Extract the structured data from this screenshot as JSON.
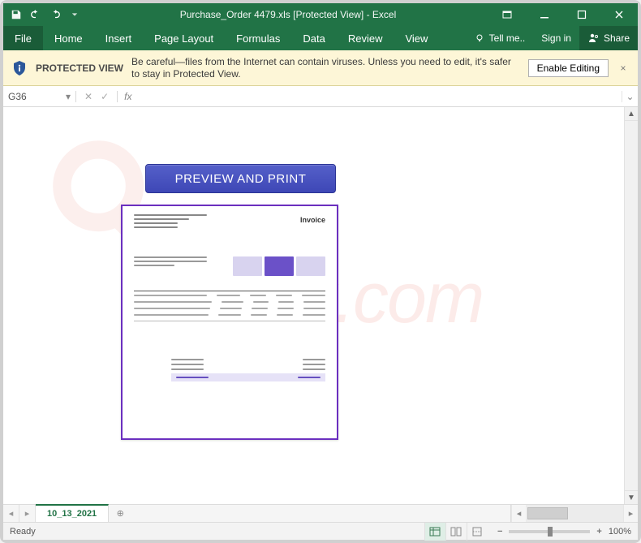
{
  "titlebar": {
    "title": "Purchase_Order 4479.xls  [Protected View] - Excel"
  },
  "ribbon": {
    "tabs": [
      "File",
      "Home",
      "Insert",
      "Page Layout",
      "Formulas",
      "Data",
      "Review",
      "View"
    ],
    "tell_me": "Tell me..",
    "sign_in": "Sign in",
    "share": "Share"
  },
  "messagebar": {
    "title": "PROTECTED VIEW",
    "text": "Be careful—files from the Internet can contain viruses. Unless you need to edit, it's safer to stay in Protected View.",
    "button": "Enable Editing"
  },
  "formula": {
    "namebox": "G36",
    "fx_label": "fx",
    "value": ""
  },
  "content": {
    "preview_button": "PREVIEW AND PRINT",
    "doc_title": "Invoice"
  },
  "tabs": {
    "sheet": "10_13_2021"
  },
  "status": {
    "ready": "Ready",
    "zoom": "100%"
  },
  "icons": {
    "save": "save",
    "undo": "undo",
    "redo": "redo",
    "restore": "restore",
    "minimize": "minimize",
    "maximize": "maximize",
    "close": "close",
    "bulb": "lightbulb",
    "person": "person-share",
    "shield": "shield-info"
  }
}
